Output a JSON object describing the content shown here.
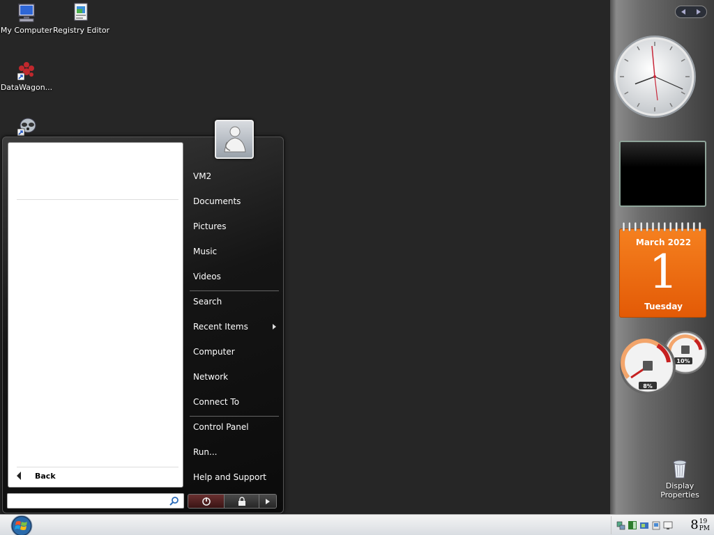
{
  "desktop": {
    "icons": [
      {
        "label": "My Computer"
      },
      {
        "label": "Registry Editor"
      },
      {
        "label": "DataWagon..."
      },
      {
        "label": ""
      }
    ]
  },
  "start_menu": {
    "left_pane": {
      "back_label": "Back",
      "search_placeholder": ""
    },
    "right_links": [
      {
        "label": "VM2"
      },
      {
        "label": "Documents"
      },
      {
        "label": "Pictures"
      },
      {
        "label": "Music"
      },
      {
        "label": "Videos"
      },
      {
        "label": "Search"
      },
      {
        "label": "Recent Items",
        "submenu": true
      },
      {
        "label": "Computer"
      },
      {
        "label": "Network"
      },
      {
        "label": "Connect To"
      },
      {
        "label": "Control Panel"
      },
      {
        "label": "Run..."
      },
      {
        "label": "Help and Support"
      }
    ],
    "power_buttons": {
      "power_icon": "power-icon",
      "lock_icon": "lock-icon",
      "more_icon": "arrow-right-icon"
    }
  },
  "sidebar": {
    "clock": {
      "hour": 8,
      "minute": 19
    },
    "calendar": {
      "month_year": "March 2022",
      "day": "1",
      "weekday": "Tuesday"
    },
    "cpu_meter": {
      "cpu_percent": "8%",
      "memory_percent": "10%"
    },
    "display_properties_label": "Display Properties"
  },
  "taskbar": {
    "clock": {
      "hour": "8",
      "minute": "19",
      "ampm": "PM"
    }
  }
}
